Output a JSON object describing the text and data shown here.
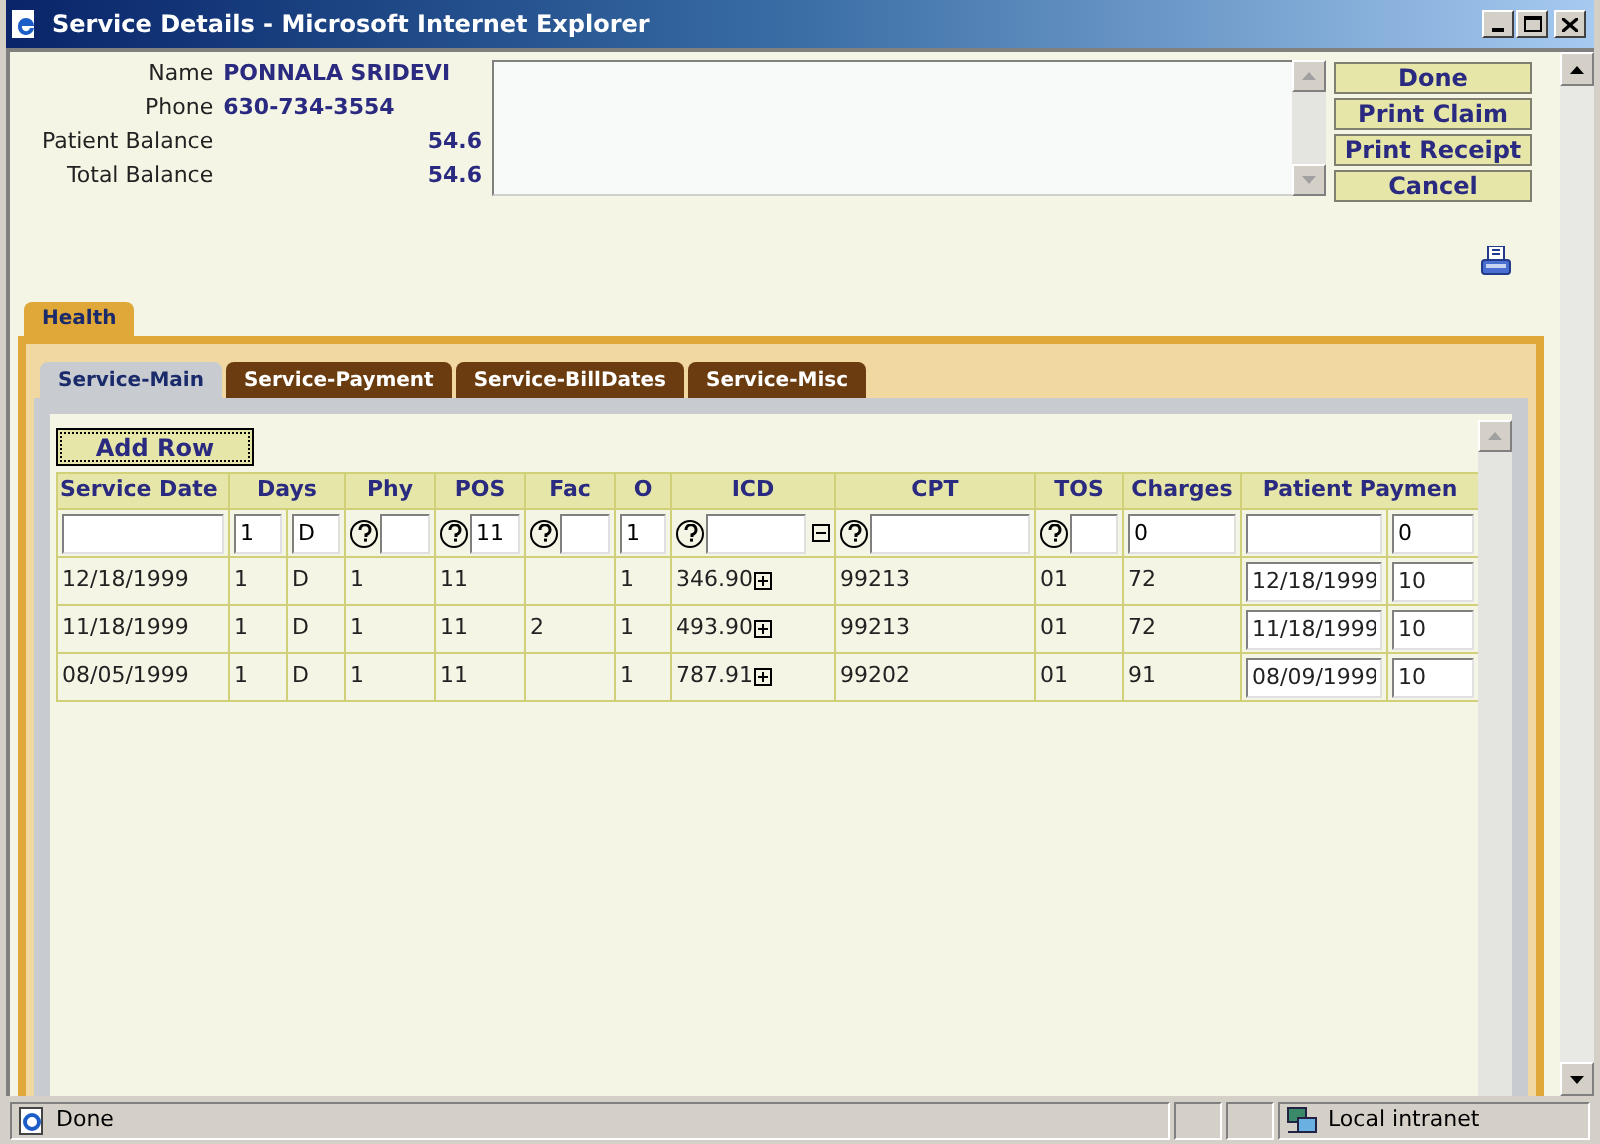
{
  "window": {
    "title": "Service Details - Microsoft Internet Explorer"
  },
  "patient": [
    {
      "label": "Name",
      "value": "PONNALA SRIDEVI",
      "kind": "left"
    },
    {
      "label": "Phone",
      "value": "630-734-3554",
      "kind": "left"
    },
    {
      "label": "Patient Balance",
      "value": "54.6",
      "kind": "right"
    },
    {
      "label": "Total Balance",
      "value": "54.6",
      "kind": "right"
    }
  ],
  "buttons": [
    "Done",
    "Print Claim",
    "Print Receipt",
    "Cancel"
  ],
  "outer_tabs": [
    {
      "label": "Health",
      "selected": true
    }
  ],
  "inner_tabs": [
    {
      "label": "Service-Main",
      "selected": true
    },
    {
      "label": "Service-Payment",
      "selected": false
    },
    {
      "label": "Service-BillDates",
      "selected": false
    },
    {
      "label": "Service-Misc",
      "selected": false
    }
  ],
  "add_row_button": "Add Row",
  "table": {
    "columns": [
      {
        "label": "Service Date"
      },
      {
        "label": "Days",
        "colspan": 2
      },
      {
        "label": "Phy"
      },
      {
        "label": "POS"
      },
      {
        "label": "Fac"
      },
      {
        "label": "O"
      },
      {
        "label": "ICD"
      },
      {
        "label": "CPT"
      },
      {
        "label": "TOS"
      },
      {
        "label": "Charges"
      },
      {
        "label": "Patient Paymen",
        "colspan": 2
      }
    ],
    "input_row": [
      {
        "kind": "field"
      },
      {
        "kind": "field",
        "value": "1"
      },
      {
        "kind": "field",
        "value": "D"
      },
      {
        "kind": "help"
      },
      {
        "kind": "help",
        "value": "11"
      },
      {
        "kind": "help"
      },
      {
        "kind": "field",
        "value": "1"
      },
      {
        "kind": "help_collapse"
      },
      {
        "kind": "help"
      },
      {
        "kind": "help"
      },
      {
        "kind": "field",
        "value": "0"
      },
      {
        "kind": "field"
      },
      {
        "kind": "field",
        "value": "0"
      }
    ],
    "rows": [
      [
        {
          "kind": "text",
          "text": "12/18/1999"
        },
        {
          "kind": "text",
          "text": "1"
        },
        {
          "kind": "text",
          "text": "D"
        },
        {
          "kind": "text",
          "text": "1"
        },
        {
          "kind": "text",
          "text": "11"
        },
        {
          "kind": "text"
        },
        {
          "kind": "text",
          "text": "1"
        },
        {
          "kind": "expand",
          "text": "346.90"
        },
        {
          "kind": "text",
          "text": "99213"
        },
        {
          "kind": "text",
          "text": "01"
        },
        {
          "kind": "text",
          "text": "72"
        },
        {
          "kind": "field",
          "text": "12/18/1999"
        },
        {
          "kind": "field",
          "text": "10"
        }
      ],
      [
        {
          "kind": "text",
          "text": "11/18/1999"
        },
        {
          "kind": "text",
          "text": "1"
        },
        {
          "kind": "text",
          "text": "D"
        },
        {
          "kind": "text",
          "text": "1"
        },
        {
          "kind": "text",
          "text": "11"
        },
        {
          "kind": "text",
          "text": "2"
        },
        {
          "kind": "text",
          "text": "1"
        },
        {
          "kind": "expand",
          "text": "493.90"
        },
        {
          "kind": "text",
          "text": "99213"
        },
        {
          "kind": "text",
          "text": "01"
        },
        {
          "kind": "text",
          "text": "72"
        },
        {
          "kind": "field",
          "text": "11/18/1999"
        },
        {
          "kind": "field",
          "text": "10"
        }
      ],
      [
        {
          "kind": "text",
          "text": "08/05/1999"
        },
        {
          "kind": "text",
          "text": "1"
        },
        {
          "kind": "text",
          "text": "D"
        },
        {
          "kind": "text",
          "text": "1"
        },
        {
          "kind": "text",
          "text": "11"
        },
        {
          "kind": "text"
        },
        {
          "kind": "text",
          "text": "1"
        },
        {
          "kind": "expand",
          "text": "787.91"
        },
        {
          "kind": "text",
          "text": "99202"
        },
        {
          "kind": "text",
          "text": "01"
        },
        {
          "kind": "text",
          "text": "91"
        },
        {
          "kind": "field",
          "text": "08/09/1999"
        },
        {
          "kind": "field",
          "text": "10"
        }
      ]
    ]
  },
  "status_bar": {
    "text": "Done",
    "zone": "Local intranet"
  }
}
